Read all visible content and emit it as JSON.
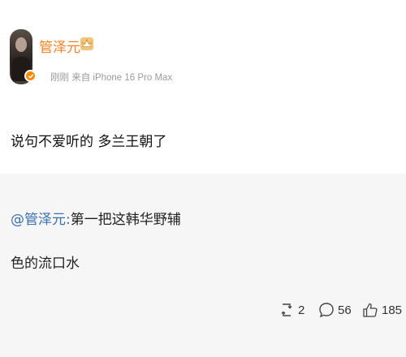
{
  "post": {
    "username": "管泽元",
    "meta": "刚刚 来自 iPhone 16 Pro Max",
    "text": "说句不爱听的 多兰王朝了"
  },
  "quoted": {
    "mention": "@管泽元:",
    "line1_rest": "第一把这韩华野辅",
    "line2": "色的流口水"
  },
  "actions": {
    "repost_count": "2",
    "comment_count": "56",
    "like_count": "185"
  },
  "icons": {
    "avatar_badge": "verified-badge-icon",
    "vip": "vip-crown-icon",
    "repost": "repost-icon",
    "comment": "comment-icon",
    "like": "like-icon"
  },
  "colors": {
    "username": "#ff7e1f",
    "mention": "#3a6fb5",
    "quoted_bg": "#f6f6f6",
    "meta": "#9a9a9a"
  }
}
